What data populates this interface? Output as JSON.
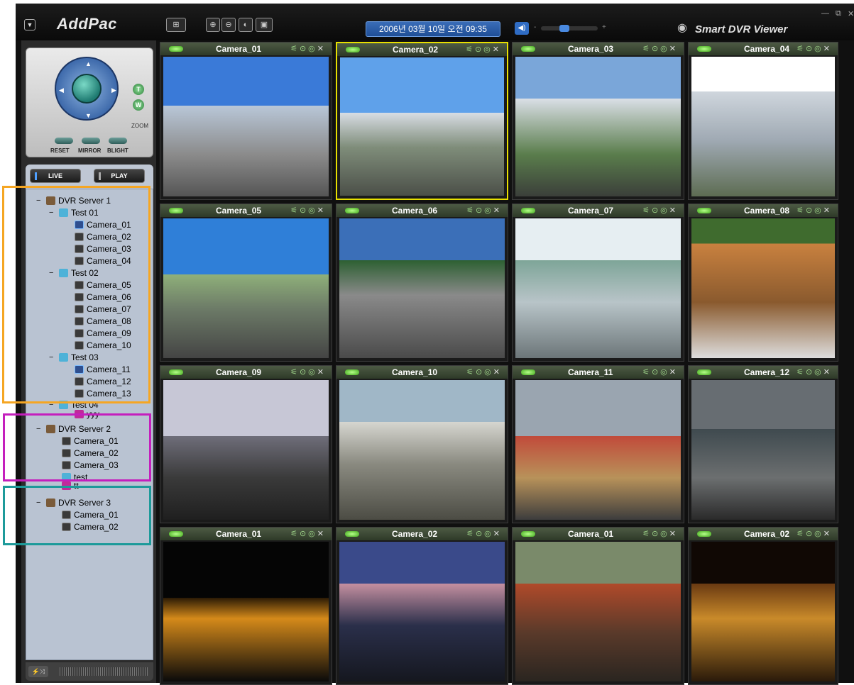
{
  "app": {
    "logo": "AddPac",
    "brand": "Smart DVR Viewer"
  },
  "toolbar": {
    "datetime": "2006년 03월 10일  오전 09:35",
    "volume": 0.4
  },
  "ptz": {
    "reset": "RESET",
    "mirror": "MIRROR",
    "blight": "BLIGHT",
    "zoom": "ZOOM",
    "tele": "T",
    "wide": "W"
  },
  "mode": {
    "live": "LIVE",
    "play": "PLAY"
  },
  "tree": {
    "server1": {
      "label": "DVR Server 1",
      "test01": "Test 01",
      "c01": "Camera_01",
      "c02": "Camera_02",
      "c03": "Camera_03",
      "c04": "Camera_04",
      "test02": "Test 02",
      "c05": "Camera_05",
      "c06": "Camera_06",
      "c07": "Camera_07",
      "c08": "Camera_08",
      "c09": "Camera_09",
      "c10": "Camera_10",
      "test03": "Test 03",
      "c11": "Camera_11",
      "c12": "Camera_12",
      "c13": "Camera_13",
      "test04": "Test 04",
      "yyy": "yyy"
    },
    "server2": {
      "label": "DVR Server 2",
      "c01": "Camera_01",
      "c02": "Camera_02",
      "c03": "Camera_03",
      "test": "test",
      "tt": "tt"
    },
    "server3": {
      "label": "DVR Server 3",
      "c01": "Camera_01",
      "c02": "Camera_02"
    }
  },
  "cameras": [
    "Camera_01",
    "Camera_02",
    "Camera_03",
    "Camera_04",
    "Camera_05",
    "Camera_06",
    "Camera_07",
    "Camera_08",
    "Camera_09",
    "Camera_10",
    "Camera_11",
    "Camera_12",
    "Camera_01",
    "Camera_02",
    "Camera_01",
    "Camera_02"
  ],
  "colors": {
    "annot_orange": "#f5a623",
    "annot_magenta": "#c41fbd",
    "annot_teal": "#1d9a9a",
    "selected": "#e8e000"
  }
}
